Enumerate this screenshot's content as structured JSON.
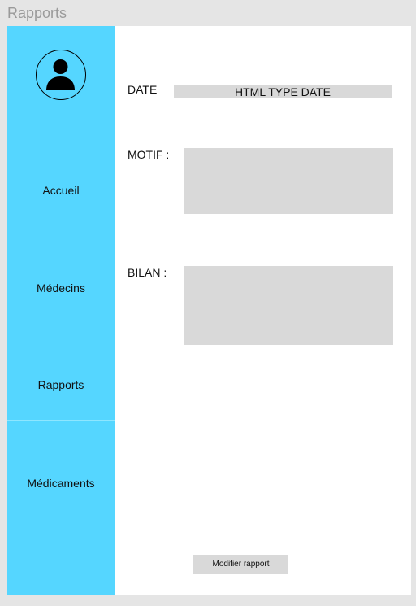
{
  "window": {
    "title": "Rapports"
  },
  "sidebar": {
    "avatar_icon": "user-icon",
    "items": [
      {
        "label": "Accueil",
        "active": false
      },
      {
        "label": "Médecins",
        "active": false
      },
      {
        "label": "Rapports",
        "active": true
      },
      {
        "label": "Médicaments",
        "active": false
      }
    ],
    "color": "#55d6ff"
  },
  "form": {
    "date_label": "DATE",
    "date_value": "HTML TYPE DATE",
    "motif_label": "MOTIF :",
    "motif_value": "",
    "bilan_label": "BILAN :",
    "bilan_value": "",
    "submit_label": "Modifier rapport"
  }
}
